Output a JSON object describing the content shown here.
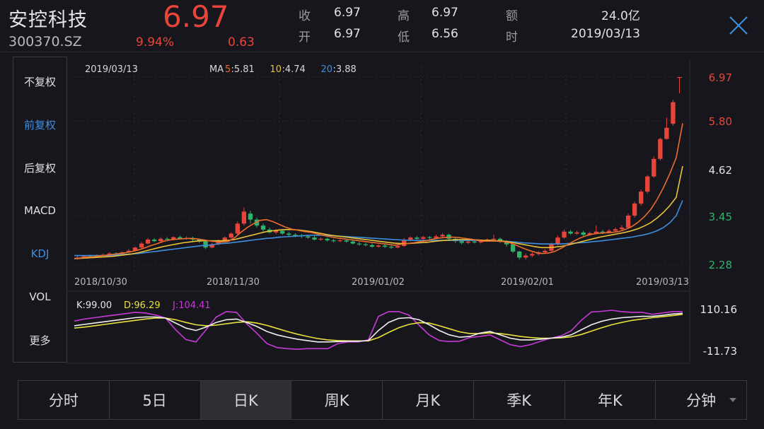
{
  "header": {
    "name": "安控科技",
    "code": "300370.SZ",
    "price": "6.97",
    "change_pct": "9.94%",
    "change": "0.63",
    "quote": [
      {
        "label": "收",
        "value": "6.97"
      },
      {
        "label": "开",
        "value": "6.97"
      },
      {
        "label": "高",
        "value": "6.97"
      },
      {
        "label": "低",
        "value": "6.56"
      },
      {
        "label": "额",
        "value": "24.0亿"
      },
      {
        "label": "时",
        "value": "2019/03/13"
      }
    ],
    "close_icon": "close-x-icon"
  },
  "sidebar": {
    "items": [
      {
        "label": "不复权",
        "active": false
      },
      {
        "label": "前复权",
        "active": true
      },
      {
        "label": "后复权",
        "active": false
      },
      {
        "label": "MACD",
        "active": false
      },
      {
        "label": "KDJ",
        "active": true
      },
      {
        "label": "VOL",
        "active": false
      },
      {
        "label": "更多",
        "active": false
      }
    ]
  },
  "kline": {
    "date": "2019/03/13",
    "ma": [
      {
        "prefix": "MA",
        "period": "5",
        "value": ":5.81",
        "color": "#e86d2d"
      },
      {
        "prefix": "",
        "period": "10",
        "value": ":4.74",
        "color": "#e8c23a"
      },
      {
        "prefix": "",
        "period": "20",
        "value": ":3.88",
        "color": "#3e8fe0"
      }
    ],
    "y_ticks": [
      {
        "label": "6.97",
        "color": "#e8453a"
      },
      {
        "label": "5.80",
        "color": "#e8453a"
      },
      {
        "label": "4.62",
        "color": "#e0e0e0"
      },
      {
        "label": "3.45",
        "color": "#2fb36a"
      },
      {
        "label": "2.28",
        "color": "#2fb36a"
      }
    ],
    "x_ticks": [
      "2018/10/30",
      "2018/11/30",
      "2019/01/02",
      "2019/02/01",
      "2019/03/13"
    ]
  },
  "kdj": {
    "k": "K:99.00",
    "d": "D:96.29",
    "j": "J:104.41",
    "y_top": "110.16",
    "y_bottom": "-11.73"
  },
  "tabs": [
    {
      "label": "分时",
      "active": false
    },
    {
      "label": "5日",
      "active": false
    },
    {
      "label": "日K",
      "active": true
    },
    {
      "label": "周K",
      "active": false
    },
    {
      "label": "月K",
      "active": false
    },
    {
      "label": "季K",
      "active": false
    },
    {
      "label": "年K",
      "active": false
    },
    {
      "label": "分钟",
      "active": false,
      "dropdown": true
    }
  ],
  "colors": {
    "up": "#e8453a",
    "down": "#2fb36a",
    "ma5": "#e86d2d",
    "ma10": "#e8c23a",
    "ma20": "#3e8fe0",
    "k_line": "#f0f0f0",
    "d_line": "#e8e23a",
    "j_line": "#c63ad6",
    "active_blue": "#3e8fe0"
  },
  "chart_data": {
    "type": "candlestick",
    "ylim": [
      2.28,
      6.97
    ],
    "candles": [
      [
        2.42,
        2.45,
        2.5,
        2.4
      ],
      [
        2.45,
        2.48,
        2.5,
        2.42
      ],
      [
        2.48,
        2.46,
        2.52,
        2.44
      ],
      [
        2.46,
        2.5,
        2.53,
        2.45
      ],
      [
        2.5,
        2.52,
        2.55,
        2.48
      ],
      [
        2.52,
        2.55,
        2.58,
        2.5
      ],
      [
        2.55,
        2.54,
        2.58,
        2.52
      ],
      [
        2.54,
        2.58,
        2.6,
        2.52
      ],
      [
        2.58,
        2.62,
        2.66,
        2.56
      ],
      [
        2.62,
        2.7,
        2.72,
        2.6
      ],
      [
        2.7,
        2.8,
        2.84,
        2.68
      ],
      [
        2.8,
        2.9,
        2.94,
        2.78
      ],
      [
        2.9,
        2.86,
        2.94,
        2.84
      ],
      [
        2.86,
        2.92,
        2.96,
        2.84
      ],
      [
        2.92,
        2.9,
        2.96,
        2.88
      ],
      [
        2.9,
        2.96,
        2.98,
        2.88
      ],
      [
        2.96,
        2.92,
        3.0,
        2.9
      ],
      [
        2.92,
        2.94,
        2.98,
        2.9
      ],
      [
        2.94,
        2.9,
        2.97,
        2.86
      ],
      [
        2.9,
        2.85,
        2.93,
        2.82
      ],
      [
        2.85,
        2.7,
        2.88,
        2.66
      ],
      [
        2.7,
        2.78,
        2.82,
        2.68
      ],
      [
        2.78,
        2.86,
        2.9,
        2.76
      ],
      [
        2.86,
        2.95,
        2.98,
        2.84
      ],
      [
        2.95,
        3.05,
        3.08,
        2.92
      ],
      [
        3.05,
        3.3,
        3.35,
        3.0
      ],
      [
        3.3,
        3.6,
        3.7,
        3.25
      ],
      [
        3.55,
        3.4,
        3.62,
        3.3
      ],
      [
        3.4,
        3.25,
        3.45,
        3.2
      ],
      [
        3.25,
        3.15,
        3.3,
        3.1
      ],
      [
        3.15,
        3.08,
        3.2,
        3.05
      ],
      [
        3.08,
        3.12,
        3.16,
        3.04
      ],
      [
        3.12,
        3.05,
        3.16,
        3.02
      ],
      [
        3.05,
        3.02,
        3.1,
        2.98
      ],
      [
        3.02,
        3.0,
        3.06,
        2.96
      ],
      [
        3.0,
        2.98,
        3.04,
        2.94
      ],
      [
        2.98,
        2.95,
        3.02,
        2.92
      ],
      [
        2.95,
        2.9,
        2.99,
        2.88
      ],
      [
        2.9,
        2.92,
        2.95,
        2.87
      ],
      [
        2.92,
        2.88,
        2.95,
        2.85
      ],
      [
        2.88,
        2.86,
        2.92,
        2.83
      ],
      [
        2.86,
        2.88,
        2.91,
        2.84
      ],
      [
        2.88,
        2.85,
        2.9,
        2.82
      ],
      [
        2.85,
        2.8,
        2.88,
        2.78
      ],
      [
        2.8,
        2.78,
        2.84,
        2.75
      ],
      [
        2.78,
        2.76,
        2.82,
        2.73
      ],
      [
        2.76,
        2.72,
        2.8,
        2.7
      ],
      [
        2.72,
        2.75,
        2.78,
        2.7
      ],
      [
        2.75,
        2.72,
        2.78,
        2.69
      ],
      [
        2.72,
        2.7,
        2.76,
        2.67
      ],
      [
        2.7,
        2.74,
        2.77,
        2.68
      ],
      [
        2.74,
        2.9,
        2.94,
        2.72
      ],
      [
        2.9,
        2.95,
        2.98,
        2.86
      ],
      [
        2.95,
        2.92,
        2.99,
        2.88
      ],
      [
        2.92,
        2.96,
        2.99,
        2.9
      ],
      [
        2.96,
        2.94,
        2.99,
        2.9
      ],
      [
        2.94,
        2.98,
        3.02,
        2.92
      ],
      [
        2.98,
        3.02,
        3.06,
        2.96
      ],
      [
        3.02,
        2.92,
        3.05,
        2.88
      ],
      [
        2.92,
        2.86,
        2.95,
        2.82
      ],
      [
        2.86,
        2.82,
        2.9,
        2.78
      ],
      [
        2.82,
        2.85,
        2.88,
        2.79
      ],
      [
        2.85,
        2.83,
        2.88,
        2.8
      ],
      [
        2.83,
        2.86,
        2.9,
        2.8
      ],
      [
        2.86,
        2.9,
        2.93,
        2.84
      ],
      [
        2.9,
        2.92,
        3.02,
        2.88
      ],
      [
        2.92,
        2.85,
        2.95,
        2.82
      ],
      [
        2.85,
        2.78,
        2.88,
        2.72
      ],
      [
        2.78,
        2.6,
        2.8,
        2.56
      ],
      [
        2.6,
        2.45,
        2.62,
        2.4
      ],
      [
        2.45,
        2.5,
        2.55,
        2.4
      ],
      [
        2.5,
        2.54,
        2.58,
        2.46
      ],
      [
        2.54,
        2.58,
        2.61,
        2.5
      ],
      [
        2.58,
        2.62,
        2.66,
        2.56
      ],
      [
        2.62,
        2.78,
        2.82,
        2.6
      ],
      [
        2.78,
        2.95,
        3.0,
        2.75
      ],
      [
        2.95,
        3.1,
        3.15,
        2.92
      ],
      [
        3.1,
        3.05,
        3.14,
        3.02
      ],
      [
        3.05,
        3.08,
        3.12,
        3.02
      ],
      [
        3.08,
        3.02,
        3.12,
        2.98
      ],
      [
        3.02,
        3.06,
        3.1,
        3.0
      ],
      [
        3.06,
        3.1,
        3.25,
        3.04
      ],
      [
        3.1,
        3.08,
        3.14,
        3.04
      ],
      [
        3.08,
        3.12,
        3.16,
        3.05
      ],
      [
        3.12,
        3.16,
        3.2,
        3.08
      ],
      [
        3.16,
        3.2,
        3.26,
        3.12
      ],
      [
        3.2,
        3.5,
        3.55,
        3.18
      ],
      [
        3.5,
        3.8,
        3.85,
        3.45
      ],
      [
        3.8,
        4.1,
        4.15,
        3.75
      ],
      [
        4.1,
        4.48,
        4.52,
        4.05
      ],
      [
        4.48,
        4.92,
        4.98,
        4.45
      ],
      [
        4.92,
        5.42,
        5.45,
        4.88
      ],
      [
        5.42,
        5.7,
        5.95,
        5.4
      ],
      [
        5.8,
        6.34,
        6.4,
        5.75
      ],
      [
        6.97,
        6.97,
        6.97,
        6.56
      ]
    ],
    "ma5": [
      2.42,
      2.44,
      2.46,
      2.47,
      2.49,
      2.51,
      2.53,
      2.55,
      2.57,
      2.6,
      2.64,
      2.69,
      2.75,
      2.8,
      2.86,
      2.89,
      2.91,
      2.92,
      2.93,
      2.92,
      2.9,
      2.87,
      2.85,
      2.84,
      2.85,
      2.94,
      3.08,
      3.2,
      3.3,
      3.38,
      3.4,
      3.35,
      3.28,
      3.21,
      3.16,
      3.13,
      3.1,
      3.08,
      3.04,
      3.0,
      2.97,
      2.94,
      2.92,
      2.9,
      2.88,
      2.86,
      2.84,
      2.82,
      2.8,
      2.78,
      2.76,
      2.78,
      2.8,
      2.82,
      2.85,
      2.87,
      2.91,
      2.94,
      2.95,
      2.96,
      2.95,
      2.93,
      2.91,
      2.88,
      2.86,
      2.86,
      2.86,
      2.85,
      2.82,
      2.76,
      2.69,
      2.63,
      2.58,
      2.55,
      2.56,
      2.6,
      2.68,
      2.77,
      2.86,
      2.94,
      3.0,
      3.04,
      3.06,
      3.07,
      3.08,
      3.1,
      3.15,
      3.22,
      3.33,
      3.47,
      3.65,
      3.9,
      4.2,
      4.55,
      4.95,
      5.81
    ],
    "ma10": [
      2.42,
      2.43,
      2.44,
      2.45,
      2.46,
      2.47,
      2.48,
      2.5,
      2.52,
      2.54,
      2.57,
      2.61,
      2.65,
      2.69,
      2.73,
      2.76,
      2.79,
      2.82,
      2.84,
      2.86,
      2.87,
      2.87,
      2.87,
      2.87,
      2.88,
      2.9,
      2.94,
      2.98,
      3.02,
      3.06,
      3.1,
      3.12,
      3.14,
      3.15,
      3.15,
      3.14,
      3.12,
      3.1,
      3.07,
      3.04,
      3.01,
      2.99,
      2.97,
      2.95,
      2.93,
      2.91,
      2.89,
      2.87,
      2.85,
      2.83,
      2.81,
      2.8,
      2.8,
      2.81,
      2.82,
      2.83,
      2.85,
      2.87,
      2.88,
      2.89,
      2.9,
      2.9,
      2.9,
      2.89,
      2.88,
      2.88,
      2.87,
      2.86,
      2.84,
      2.81,
      2.78,
      2.75,
      2.72,
      2.7,
      2.7,
      2.71,
      2.73,
      2.76,
      2.8,
      2.84,
      2.88,
      2.92,
      2.96,
      2.99,
      3.02,
      3.05,
      3.08,
      3.12,
      3.17,
      3.24,
      3.32,
      3.44,
      3.58,
      3.75,
      3.96,
      4.74
    ],
    "ma20": [
      2.5,
      2.5,
      2.5,
      2.5,
      2.5,
      2.5,
      2.51,
      2.52,
      2.53,
      2.54,
      2.55,
      2.57,
      2.59,
      2.61,
      2.63,
      2.65,
      2.67,
      2.69,
      2.71,
      2.73,
      2.75,
      2.76,
      2.78,
      2.8,
      2.81,
      2.83,
      2.85,
      2.87,
      2.89,
      2.91,
      2.93,
      2.94,
      2.96,
      2.97,
      2.98,
      2.99,
      3.0,
      3.01,
      3.01,
      3.01,
      3.0,
      2.99,
      2.98,
      2.97,
      2.96,
      2.95,
      2.94,
      2.93,
      2.92,
      2.91,
      2.9,
      2.89,
      2.88,
      2.88,
      2.88,
      2.88,
      2.88,
      2.88,
      2.88,
      2.88,
      2.88,
      2.88,
      2.88,
      2.88,
      2.87,
      2.87,
      2.86,
      2.86,
      2.85,
      2.84,
      2.82,
      2.81,
      2.8,
      2.79,
      2.79,
      2.79,
      2.79,
      2.8,
      2.81,
      2.82,
      2.83,
      2.85,
      2.86,
      2.88,
      2.9,
      2.92,
      2.94,
      2.96,
      2.99,
      3.02,
      3.06,
      3.12,
      3.2,
      3.32,
      3.5,
      3.88
    ],
    "kdj_ylim": [
      -11.73,
      110.16
    ],
    "k": [
      62,
      66,
      70,
      74,
      78,
      82,
      86,
      88,
      88,
      85,
      70,
      55,
      48,
      58,
      72,
      80,
      82,
      72,
      60,
      45,
      35,
      28,
      22,
      18,
      14,
      14,
      15,
      16,
      16,
      18,
      48,
      72,
      84,
      86,
      80,
      65,
      48,
      35,
      28,
      30,
      40,
      45,
      35,
      25,
      20,
      20,
      22,
      25,
      28,
      35,
      50,
      65,
      75,
      82,
      86,
      88,
      90,
      90,
      93,
      97,
      99
    ],
    "d": [
      55,
      58,
      62,
      66,
      70,
      74,
      78,
      82,
      85,
      85,
      80,
      72,
      65,
      62,
      64,
      68,
      72,
      74,
      70,
      63,
      54,
      45,
      37,
      30,
      24,
      20,
      18,
      17,
      17,
      17,
      27,
      42,
      56,
      66,
      71,
      70,
      62,
      53,
      44,
      39,
      39,
      41,
      39,
      35,
      30,
      27,
      25,
      25,
      26,
      29,
      36,
      46,
      56,
      65,
      72,
      78,
      82,
      86,
      89,
      92,
      96
    ],
    "j": [
      76,
      82,
      86,
      90,
      94,
      98,
      102,
      100,
      94,
      85,
      50,
      21,
      14,
      50,
      88,
      104,
      102,
      68,
      40,
      9,
      -3,
      -6,
      -8,
      -6,
      -6,
      -6,
      9,
      14,
      14,
      20,
      90,
      104,
      104,
      94,
      64,
      35,
      18,
      15,
      16,
      27,
      30,
      35,
      20,
      6,
      0,
      6,
      16,
      25,
      32,
      47,
      78,
      103,
      105,
      108,
      104,
      102,
      102,
      96,
      100,
      104,
      104
    ]
  }
}
